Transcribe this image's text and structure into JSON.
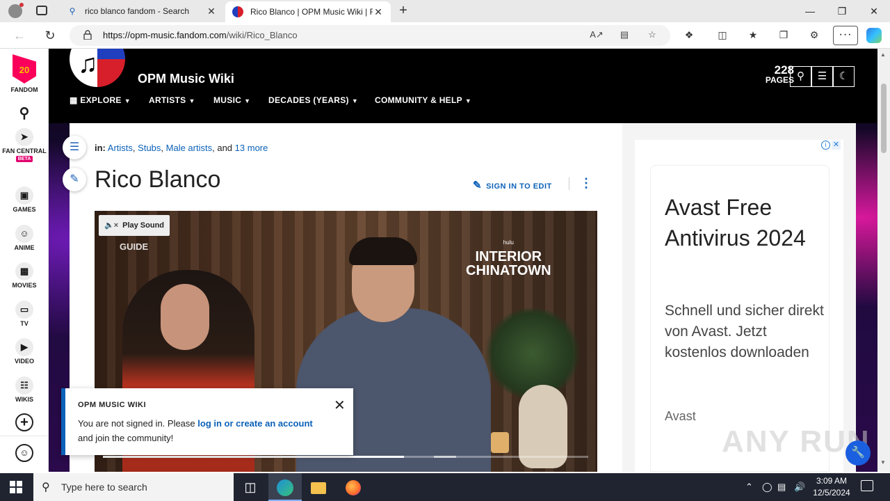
{
  "browser": {
    "tabs": [
      {
        "title": "rico blanco fandom - Search",
        "icon": "search-icon"
      },
      {
        "title": "Rico Blanco | OPM Music Wiki | F",
        "icon": "wiki-favicon"
      }
    ],
    "url_host": "https://opm-music.fandom.com",
    "url_path": "/wiki/Rico_Blanco"
  },
  "rail": {
    "brand": "FANDOM",
    "badge": "20",
    "items": [
      {
        "label": "FAN CENTRAL",
        "badge": "BETA"
      },
      {
        "label": "GAMES"
      },
      {
        "label": "ANIME"
      },
      {
        "label": "MOVIES"
      },
      {
        "label": "TV"
      },
      {
        "label": "VIDEO"
      },
      {
        "label": "WIKIS"
      }
    ]
  },
  "wiki": {
    "name": "OPM Music Wiki",
    "pages_count": "228",
    "pages_label": "PAGES",
    "nav": [
      "EXPLORE",
      "ARTISTS",
      "MUSIC",
      "DECADES (YEARS)",
      "COMMUNITY & HELP"
    ]
  },
  "article": {
    "categories_label": "in:",
    "categories": [
      "Artists",
      "Stubs",
      "Male artists"
    ],
    "categories_and": "and",
    "categories_more": "13 more",
    "title": "Rico Blanco",
    "sign_in_edit": "SIGN IN TO EDIT"
  },
  "video": {
    "play_sound": "Play Sound",
    "channel_label": "GUIDE",
    "logo_small": "hulu",
    "logo_line1": "INTERIOR",
    "logo_line2": "CHINATOWN",
    "progress": 0.62
  },
  "ad": {
    "title": "Avast Free Antivirus 2024",
    "body": "Schnell und sicher direkt von Avast. Jetzt kostenlos downloaden",
    "brand": "Avast"
  },
  "toast": {
    "heading": "OPM MUSIC WIKI",
    "msg_prefix": "You are not signed in. Please",
    "link": "log in or create an account",
    "msg_suffix": "and join the community!"
  },
  "watermark": "ANY RUN",
  "taskbar": {
    "search_placeholder": "Type here to search",
    "time": "3:09 AM",
    "date": "12/5/2024"
  }
}
